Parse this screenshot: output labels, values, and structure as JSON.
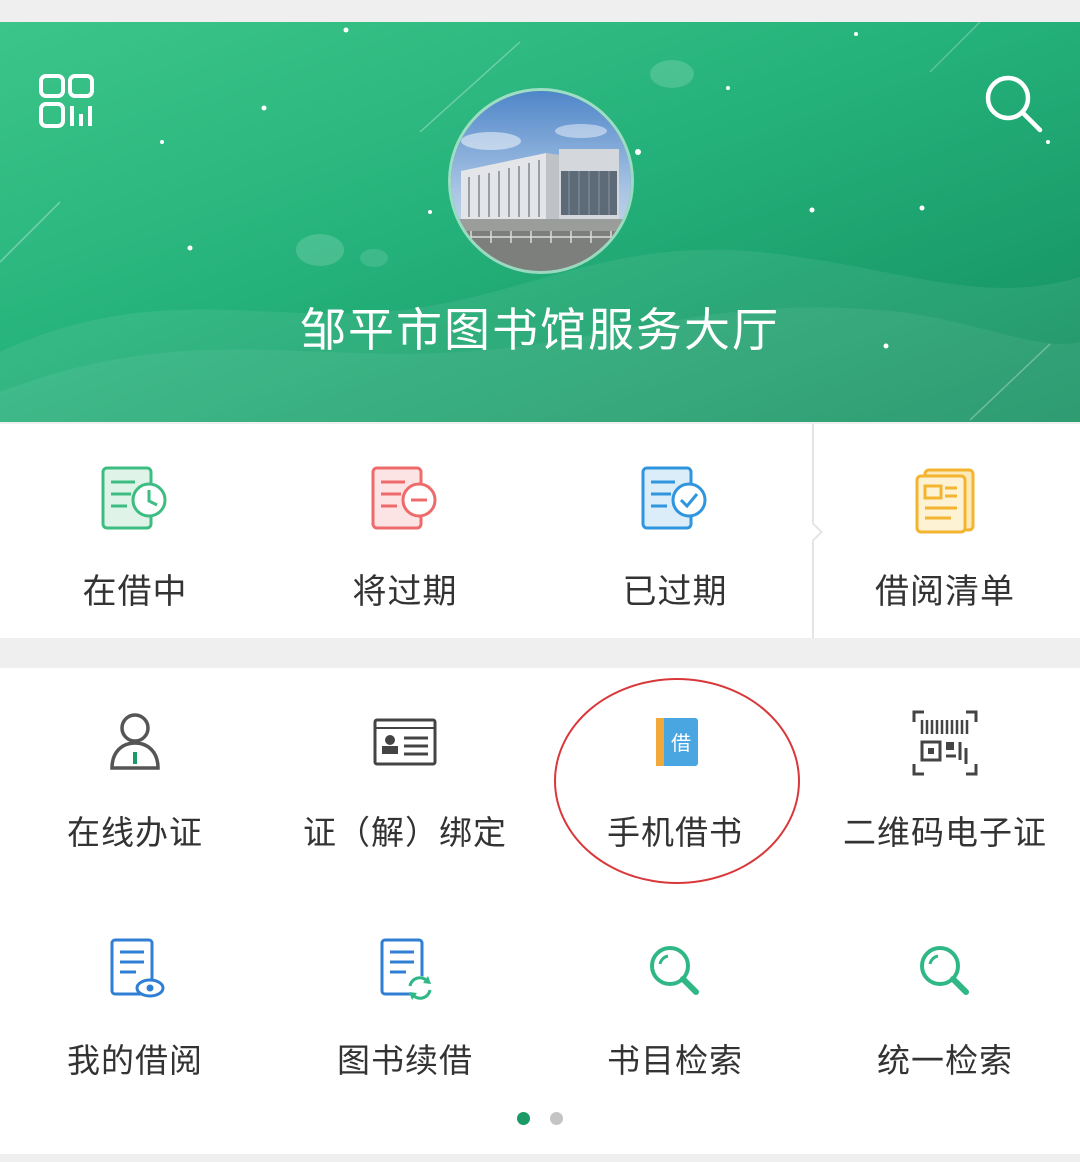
{
  "header": {
    "title": "邹平市图书馆服务大厅",
    "left_icon": "qr-code-icon",
    "right_icon": "search-icon",
    "avatar_alt": "library-building-photo"
  },
  "stats": [
    {
      "label": "在借中",
      "icon": "borrowing-icon",
      "color": "#3dbd82"
    },
    {
      "label": "将过期",
      "icon": "expiring-icon",
      "color": "#ef6b6b"
    },
    {
      "label": "已过期",
      "icon": "expired-icon",
      "color": "#2f95de"
    },
    {
      "label": "借阅清单",
      "icon": "borrow-list-icon",
      "color": "#f3b530"
    }
  ],
  "services": [
    {
      "label": "在线办证",
      "icon": "user-icon"
    },
    {
      "label": "证（解）绑定",
      "icon": "id-card-icon"
    },
    {
      "label": "手机借书",
      "icon": "book-borrow-icon",
      "badge": "借"
    },
    {
      "label": "二维码电子证",
      "icon": "barcode-card-icon"
    },
    {
      "label": "我的借阅",
      "icon": "my-borrow-icon"
    },
    {
      "label": "图书续借",
      "icon": "renew-icon"
    },
    {
      "label": "书目检索",
      "icon": "catalog-search-icon"
    },
    {
      "label": "统一检索",
      "icon": "unified-search-icon"
    }
  ],
  "pagination": {
    "pages": 2,
    "active": 1
  },
  "colors": {
    "brand": "#1a9a67",
    "highlight": "#d9383a"
  }
}
